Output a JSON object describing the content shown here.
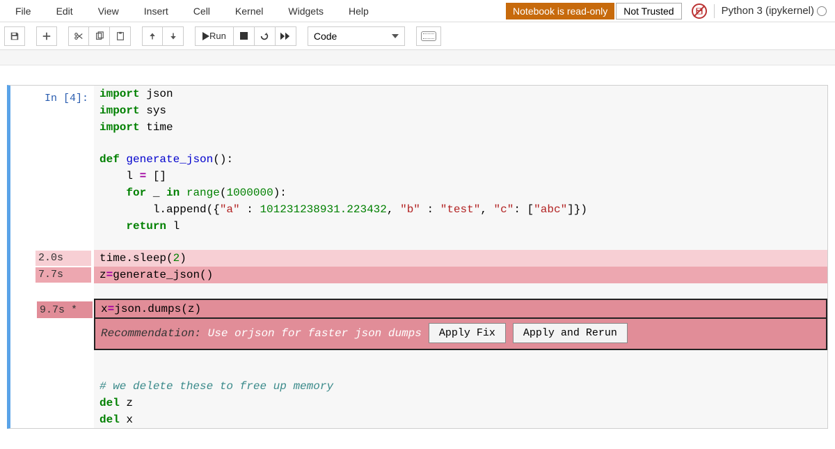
{
  "menu": {
    "items": [
      "File",
      "Edit",
      "View",
      "Insert",
      "Cell",
      "Kernel",
      "Widgets",
      "Help"
    ]
  },
  "header": {
    "readonly_badge": "Notebook is read-only",
    "nottrusted_badge": "Not Trusted",
    "kernel_name": "Python 3 (ipykernel)"
  },
  "toolbar": {
    "run_label": " Run",
    "cell_type": "Code"
  },
  "cell": {
    "prompt": "In [4]:",
    "lines": {
      "l0": "import",
      "l0b": " json",
      "l1": "import",
      "l1b": " sys",
      "l2": "import",
      "l2b": " time",
      "l3": "",
      "l4a": "def",
      "l4b": " ",
      "l4c": "generate_json",
      "l4d": "():",
      "l5": "    l ",
      "l5b": "=",
      "l5c": " []",
      "l6a": "    ",
      "l6b": "for",
      "l6c": " _ ",
      "l6d": "in",
      "l6e": " ",
      "l6f": "range",
      "l6g": "(",
      "l6h": "1000000",
      "l6i": "):",
      "l7a": "        l.append({",
      "l7b": "\"a\"",
      "l7c": " : ",
      "l7d": "101231238931.223432",
      "l7e": ", ",
      "l7f": "\"b\"",
      "l7g": " : ",
      "l7h": "\"test\"",
      "l7i": ", ",
      "l7j": "\"c\"",
      "l7k": ": [",
      "l7l": "\"abc\"",
      "l7m": "]})",
      "l8a": "    ",
      "l8b": "return",
      "l8c": " l",
      "l9": "",
      "l10": "time.sleep(",
      "l10b": "2",
      "l10c": ")",
      "l11a": "z",
      "l11b": "=",
      "l11c": "generate_json()",
      "l12": "",
      "l13a": "x",
      "l13b": "=",
      "l13c": "json.dumps(z)",
      "l14": "",
      "l15": "# we delete these to free up memory",
      "l16a": "del",
      "l16b": " z",
      "l17a": "del",
      "l17b": " x"
    },
    "timings": {
      "t10": "2.0s",
      "t11": "7.7s",
      "t13": "9.7s *"
    },
    "recommendation": {
      "label": "Recommendation: ",
      "text": "Use orjson for faster json dumps",
      "apply_fix": "Apply Fix",
      "apply_rerun": "Apply and Rerun"
    }
  }
}
